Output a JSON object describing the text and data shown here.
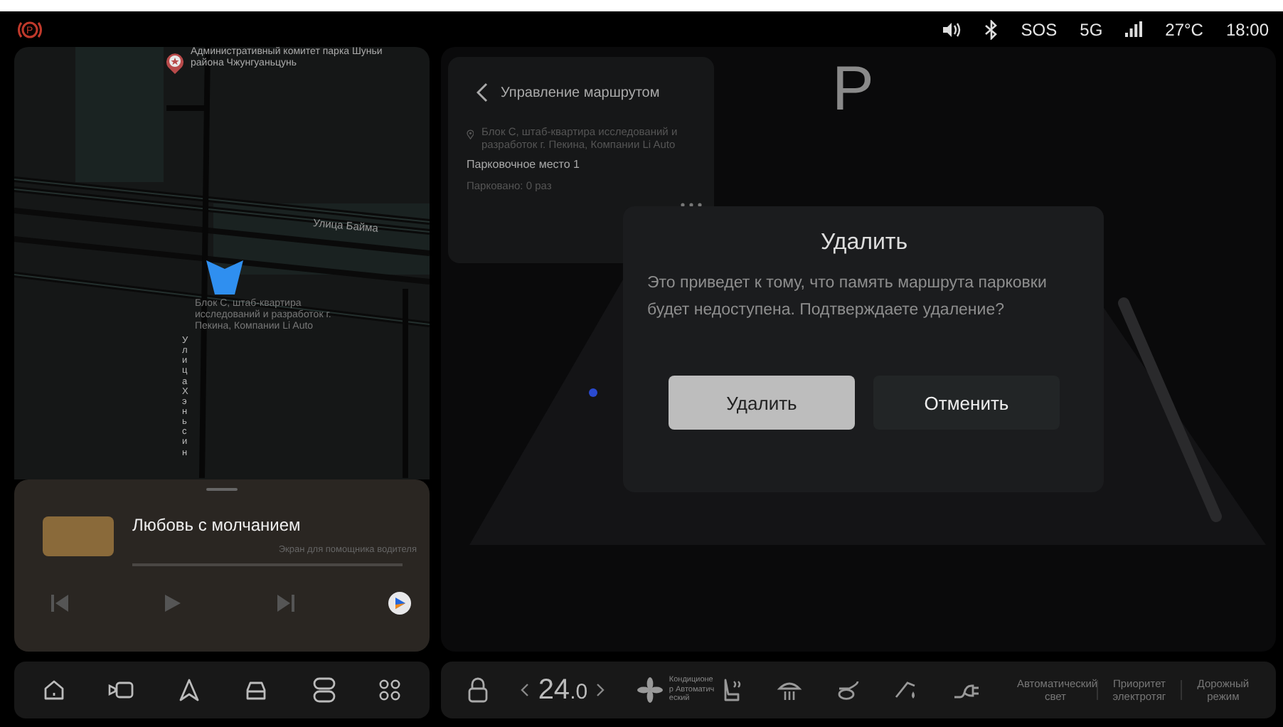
{
  "status_bar": {
    "brake_symbol": "P",
    "items": [
      "SOS",
      "5G",
      "27°C",
      "18:00"
    ]
  },
  "map": {
    "poi": "Административный комитет парка Шуньи района Чжунгуаньцунь",
    "street_horizontal": "Улица Байма",
    "street_vertical": "УлицаХэньсин",
    "location": "Блок С, штаб-квартира исследований и разработок г. Пекина, Компании Li Auto"
  },
  "media": {
    "title": "Любовь с молчанием",
    "subtitle": "Экран для помощника водителя"
  },
  "route_card": {
    "title": "Управление маршрутом",
    "address": "Блок С, штаб-квартира исследований и разработок г. Пекина, Компании Li Auto",
    "slot": "Парковочное место 1",
    "parked": "Парковано: 0 раз"
  },
  "gear": "P",
  "dialog": {
    "title": "Удалить",
    "message": "Это приведет к тому, что память маршрута парковки будет недоступена. Подтверждаете удаление?",
    "buttons": [
      {
        "label": "Удалить",
        "kind": "primary"
      },
      {
        "label": "Отменить",
        "kind": "secondary"
      }
    ]
  },
  "climate": {
    "temperature": "24",
    "temperature_decimal": ".0",
    "fan_label": "Кондиционер Автоматический",
    "quick": [
      {
        "label": "Автоматический свет"
      },
      {
        "label": "Приоритет электротяг"
      },
      {
        "label": "Дорожный режим"
      }
    ]
  }
}
